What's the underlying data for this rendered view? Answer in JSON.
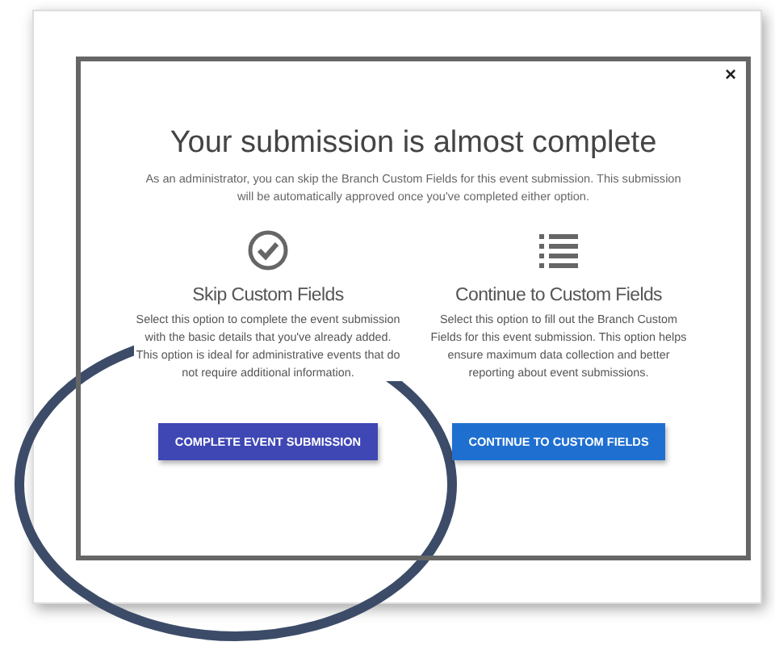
{
  "dialog": {
    "close": "×",
    "title": "Your submission is almost complete",
    "intro": "As an administrator, you can skip the Branch Custom Fields for this event submission. This submission will be automatically approved once you've completed either option.",
    "options": [
      {
        "kind": "check",
        "heading": "Skip Custom Fields",
        "text": "Select this option to complete the event submission with the basic details that you've already added. This option is ideal for administrative events that do not require additional information.",
        "button": "COMPLETE EVENT SUBMISSION",
        "color": "#3f47b5"
      },
      {
        "kind": "list",
        "heading": "Continue to Custom Fields",
        "text": "Select this option to fill out the Branch Custom Fields for this event submission. This option helps ensure maximum data collection and better reporting about event submissions.",
        "button": "CONTINUE TO CUSTOM FIELDS",
        "color": "#1f6fd0"
      }
    ]
  }
}
